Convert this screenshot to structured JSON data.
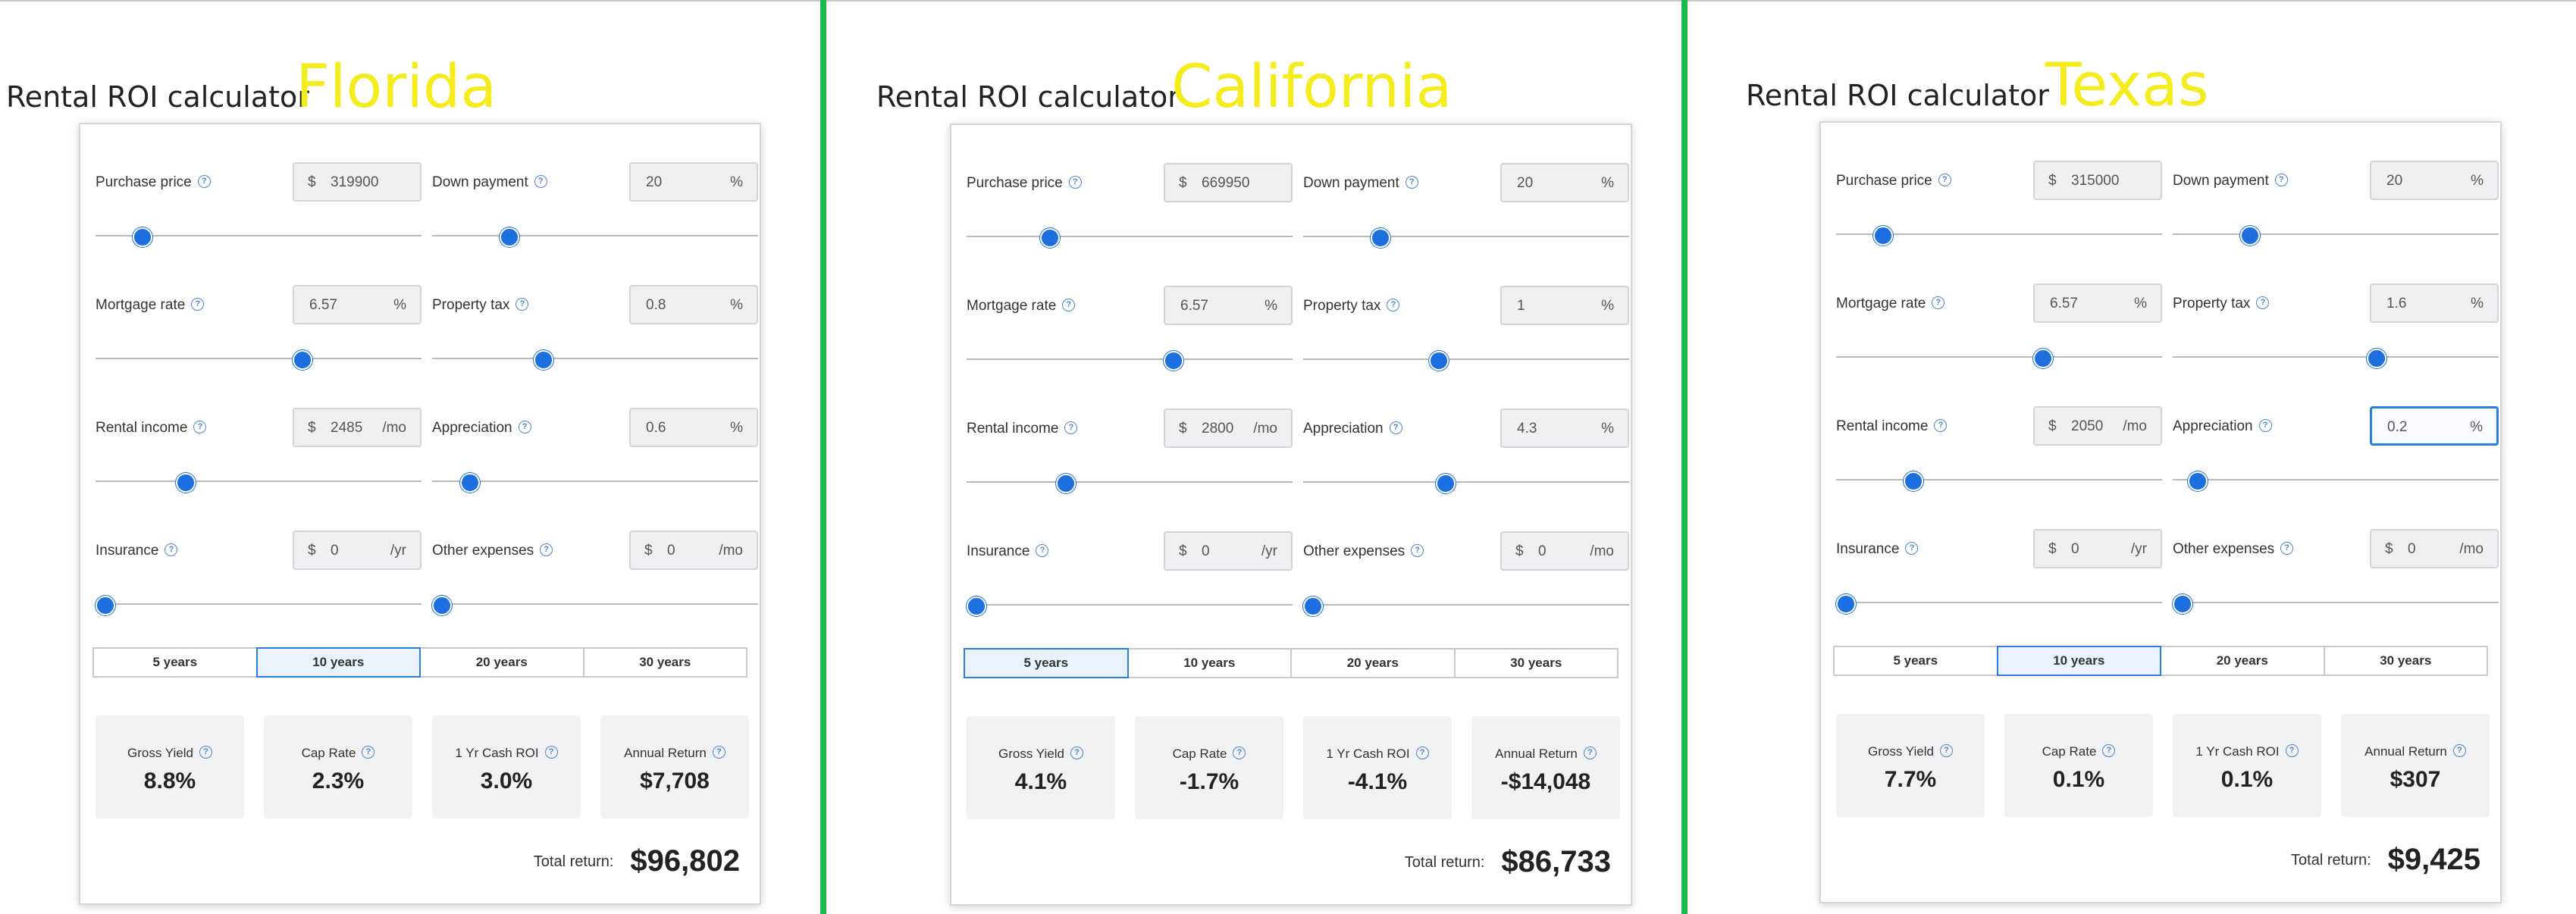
{
  "panels": [
    {
      "heading": "Rental ROI calculator",
      "state": "Florida",
      "fields": [
        {
          "label": "Purchase price",
          "prefix": "$",
          "value": "319900",
          "suffix": "",
          "slider": 0.12
        },
        {
          "label": "Down payment",
          "prefix": "",
          "value": "20",
          "suffix": "%",
          "slider": 0.22
        },
        {
          "label": "Mortgage rate",
          "prefix": "",
          "value": "6.57",
          "suffix": "%",
          "slider": 0.64
        },
        {
          "label": "Property tax",
          "prefix": "",
          "value": "0.8",
          "suffix": "%",
          "slider": 0.33
        },
        {
          "label": "Rental income",
          "prefix": "$",
          "value": "2485",
          "suffix": "/mo",
          "slider": 0.26
        },
        {
          "label": "Appreciation",
          "prefix": "",
          "value": "0.6",
          "suffix": "%",
          "slider": 0.09
        },
        {
          "label": "Insurance",
          "prefix": "$",
          "value": "0",
          "suffix": "/yr",
          "slider": 0.0
        },
        {
          "label": "Other expenses",
          "prefix": "$",
          "value": "0",
          "suffix": "/mo",
          "slider": 0.0
        }
      ],
      "periods": [
        "5 years",
        "10 years",
        "20 years",
        "30 years"
      ],
      "active_period": 1,
      "metrics": [
        {
          "label": "Gross Yield",
          "value": "8.8%"
        },
        {
          "label": "Cap Rate",
          "value": "2.3%"
        },
        {
          "label": "1 Yr Cash ROI",
          "value": "3.0%"
        },
        {
          "label": "Annual Return",
          "value": "$7,708"
        }
      ],
      "total_label": "Total return:",
      "total_value": "$96,802"
    },
    {
      "heading": "Rental ROI calculator",
      "state": "California",
      "fields": [
        {
          "label": "Purchase price",
          "prefix": "$",
          "value": "669950",
          "suffix": "",
          "slider": 0.24
        },
        {
          "label": "Down payment",
          "prefix": "",
          "value": "20",
          "suffix": "%",
          "slider": 0.22
        },
        {
          "label": "Mortgage rate",
          "prefix": "",
          "value": "6.57",
          "suffix": "%",
          "slider": 0.64
        },
        {
          "label": "Property tax",
          "prefix": "",
          "value": "1",
          "suffix": "%",
          "slider": 0.41
        },
        {
          "label": "Rental income",
          "prefix": "$",
          "value": "2800",
          "suffix": "/mo",
          "slider": 0.29
        },
        {
          "label": "Appreciation",
          "prefix": "",
          "value": "4.3",
          "suffix": "%",
          "slider": 0.43
        },
        {
          "label": "Insurance",
          "prefix": "$",
          "value": "0",
          "suffix": "/yr",
          "slider": 0.0
        },
        {
          "label": "Other expenses",
          "prefix": "$",
          "value": "0",
          "suffix": "/mo",
          "slider": 0.0
        }
      ],
      "periods": [
        "5 years",
        "10 years",
        "20 years",
        "30 years"
      ],
      "active_period": 0,
      "metrics": [
        {
          "label": "Gross Yield",
          "value": "4.1%"
        },
        {
          "label": "Cap Rate",
          "value": "-1.7%"
        },
        {
          "label": "1 Yr Cash ROI",
          "value": "-4.1%"
        },
        {
          "label": "Annual Return",
          "value": "-$14,048"
        }
      ],
      "total_label": "Total return:",
      "total_value": "$86,733"
    },
    {
      "heading": "Rental ROI calculator",
      "state": "Texas",
      "fields": [
        {
          "label": "Purchase price",
          "prefix": "$",
          "value": "315000",
          "suffix": "",
          "slider": 0.12
        },
        {
          "label": "Down payment",
          "prefix": "",
          "value": "20",
          "suffix": "%",
          "slider": 0.22
        },
        {
          "label": "Mortgage rate",
          "prefix": "",
          "value": "6.57",
          "suffix": "%",
          "slider": 0.64
        },
        {
          "label": "Property tax",
          "prefix": "",
          "value": "1.6",
          "suffix": "%",
          "slider": 0.63
        },
        {
          "label": "Rental income",
          "prefix": "$",
          "value": "2050",
          "suffix": "/mo",
          "slider": 0.22
        },
        {
          "label": "Appreciation",
          "prefix": "",
          "value": "0.2",
          "suffix": "%",
          "slider": 0.05,
          "focused": true
        },
        {
          "label": "Insurance",
          "prefix": "$",
          "value": "0",
          "suffix": "/yr",
          "slider": 0.0
        },
        {
          "label": "Other expenses",
          "prefix": "$",
          "value": "0",
          "suffix": "/mo",
          "slider": 0.0
        }
      ],
      "periods": [
        "5 years",
        "10 years",
        "20 years",
        "30 years"
      ],
      "active_period": 1,
      "metrics": [
        {
          "label": "Gross Yield",
          "value": "7.7%"
        },
        {
          "label": "Cap Rate",
          "value": "0.1%"
        },
        {
          "label": "1 Yr Cash ROI",
          "value": "0.1%"
        },
        {
          "label": "Annual Return",
          "value": "$307"
        }
      ],
      "total_label": "Total return:",
      "total_value": "$9,425"
    }
  ],
  "colors": {
    "accent": "#1d6fe0",
    "divider": "#1fb84a",
    "state_label": "#f5ec1e"
  }
}
